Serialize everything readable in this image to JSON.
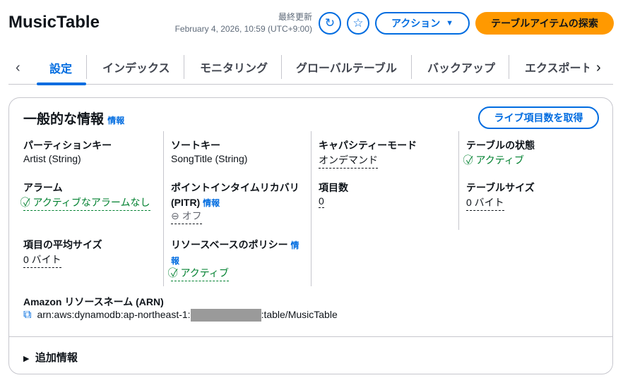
{
  "header": {
    "title": "MusicTable",
    "last_updated_label": "最終更新",
    "last_updated": "February 4, 2026, 10:59 (UTC+9:00)",
    "actions_label": "アクション",
    "explore_label": "テーブルアイテムの探索"
  },
  "tabs": [
    "設定",
    "インデックス",
    "モニタリング",
    "グローバルテーブル",
    "バックアップ",
    "エクスポート"
  ],
  "active_tab": "設定",
  "card": {
    "title": "一般的な情報",
    "info": "情報",
    "live_button": "ライブ項目数を取得",
    "fields": {
      "partition_key": {
        "label": "パーティションキー",
        "value": "Artist (String)"
      },
      "alarms": {
        "label": "アラーム",
        "value": "アクティブなアラームなし"
      },
      "avg_size": {
        "label": "項目の平均サイズ",
        "value": "0 バイト"
      },
      "sort_key": {
        "label": "ソートキー",
        "value": "SongTitle (String)"
      },
      "pitr": {
        "label": "ポイントインタイムリカバリ (PITR)",
        "info": "情報",
        "value": "オフ"
      },
      "policy": {
        "label": "リソースベースのポリシー",
        "info": "情報",
        "value": "アクティブ"
      },
      "capacity": {
        "label": "キャパシティーモード",
        "value": "オンデマンド"
      },
      "item_count": {
        "label": "項目数",
        "value": "0"
      },
      "status": {
        "label": "テーブルの状態",
        "value": "アクティブ"
      },
      "size": {
        "label": "テーブルサイズ",
        "value": "0 バイト"
      },
      "arn": {
        "label": "Amazon リソースネーム (ARN)",
        "prefix": "arn:aws:dynamodb:ap-northeast-1:",
        "suffix": ":table/MusicTable"
      }
    },
    "additional": "追加情報"
  },
  "colors": {
    "accent": "#006ce0",
    "primary_button": "#ff9900",
    "success": "#00802f"
  }
}
